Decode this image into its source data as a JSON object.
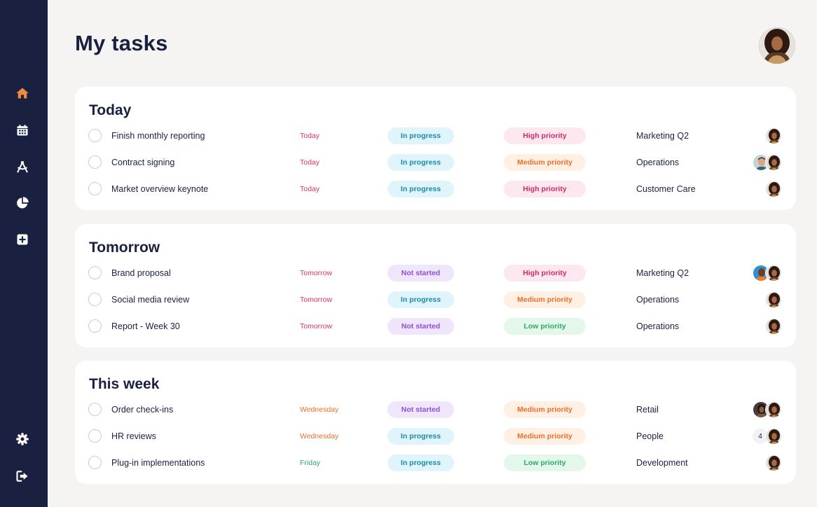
{
  "page": {
    "title": "My tasks"
  },
  "colors": {
    "sidebar": "#1a2140",
    "accent": "#f08a3c",
    "due_today": "#d6336c",
    "due_tomorrow": "#d6336c",
    "due_wednesday": "#e8702a",
    "due_friday": "#2fa865",
    "status_in_progress_bg": "#dff5fb",
    "status_in_progress_fg": "#1b8aa8",
    "status_not_started_bg": "#efe6fb",
    "status_not_started_fg": "#8d4fd6",
    "priority_high_bg": "#fde8ef",
    "priority_high_fg": "#d1296a",
    "priority_medium_bg": "#fff0e3",
    "priority_medium_fg": "#e8702a",
    "priority_low_bg": "#e3f8ea",
    "priority_low_fg": "#2fa865"
  },
  "sidebar": {
    "items": [
      {
        "icon": "home-icon",
        "active": true
      },
      {
        "icon": "calendar-icon",
        "active": false
      },
      {
        "icon": "compass-icon",
        "active": false
      },
      {
        "icon": "pie-chart-icon",
        "active": false
      },
      {
        "icon": "plus-square-icon",
        "active": false
      }
    ],
    "bottom": [
      {
        "icon": "gear-icon"
      },
      {
        "icon": "logout-icon"
      }
    ]
  },
  "sections": [
    {
      "title": "Today",
      "tasks": [
        {
          "name": "Finish monthly reporting",
          "due": "Today",
          "due_color": "today",
          "status": "In progress",
          "status_type": "in_progress",
          "priority": "High priority",
          "priority_type": "high",
          "team": "Marketing Q2",
          "assignees": [
            "woman"
          ]
        },
        {
          "name": "Contract signing",
          "due": "Today",
          "due_color": "today",
          "status": "In progress",
          "status_type": "in_progress",
          "priority": "Medium priority",
          "priority_type": "medium",
          "team": "Operations",
          "assignees": [
            "woman",
            "man"
          ]
        },
        {
          "name": "Market overview keynote",
          "due": "Today",
          "due_color": "today",
          "status": "In progress",
          "status_type": "in_progress",
          "priority": "High priority",
          "priority_type": "high",
          "team": "Customer Care",
          "assignees": [
            "woman"
          ]
        }
      ]
    },
    {
      "title": "Tomorrow",
      "tasks": [
        {
          "name": "Brand proposal",
          "due": "Tomorrow",
          "due_color": "tomorrow",
          "status": "Not started",
          "status_type": "not_started",
          "priority": "High priority",
          "priority_type": "high",
          "team": "Marketing Q2",
          "assignees": [
            "woman",
            "orange"
          ]
        },
        {
          "name": "Social media review",
          "due": "Tomorrow",
          "due_color": "tomorrow",
          "status": "In progress",
          "status_type": "in_progress",
          "priority": "Medium priority",
          "priority_type": "medium",
          "team": "Operations",
          "assignees": [
            "woman"
          ]
        },
        {
          "name": "Report - Week 30",
          "due": "Tomorrow",
          "due_color": "tomorrow",
          "status": "Not started",
          "status_type": "not_started",
          "priority": "Low priority",
          "priority_type": "low",
          "team": "Operations",
          "assignees": [
            "woman"
          ]
        }
      ]
    },
    {
      "title": "This week",
      "tasks": [
        {
          "name": "Order check-ins",
          "due": "Wednesday",
          "due_color": "wednesday",
          "status": "Not started",
          "status_type": "not_started",
          "priority": "Medium priority",
          "priority_type": "medium",
          "team": "Retail",
          "assignees": [
            "woman",
            "dark"
          ]
        },
        {
          "name": "HR reviews",
          "due": "Wednesday",
          "due_color": "wednesday",
          "status": "In progress",
          "status_type": "in_progress",
          "priority": "Medium priority",
          "priority_type": "medium",
          "team": "People",
          "assignees": [
            "woman"
          ],
          "extra_count": "4"
        },
        {
          "name": "Plug-in implementations",
          "due": "Friday",
          "due_color": "friday",
          "status": "In progress",
          "status_type": "in_progress",
          "priority": "Low priority",
          "priority_type": "low",
          "team": "Development",
          "assignees": [
            "woman"
          ]
        }
      ]
    }
  ]
}
